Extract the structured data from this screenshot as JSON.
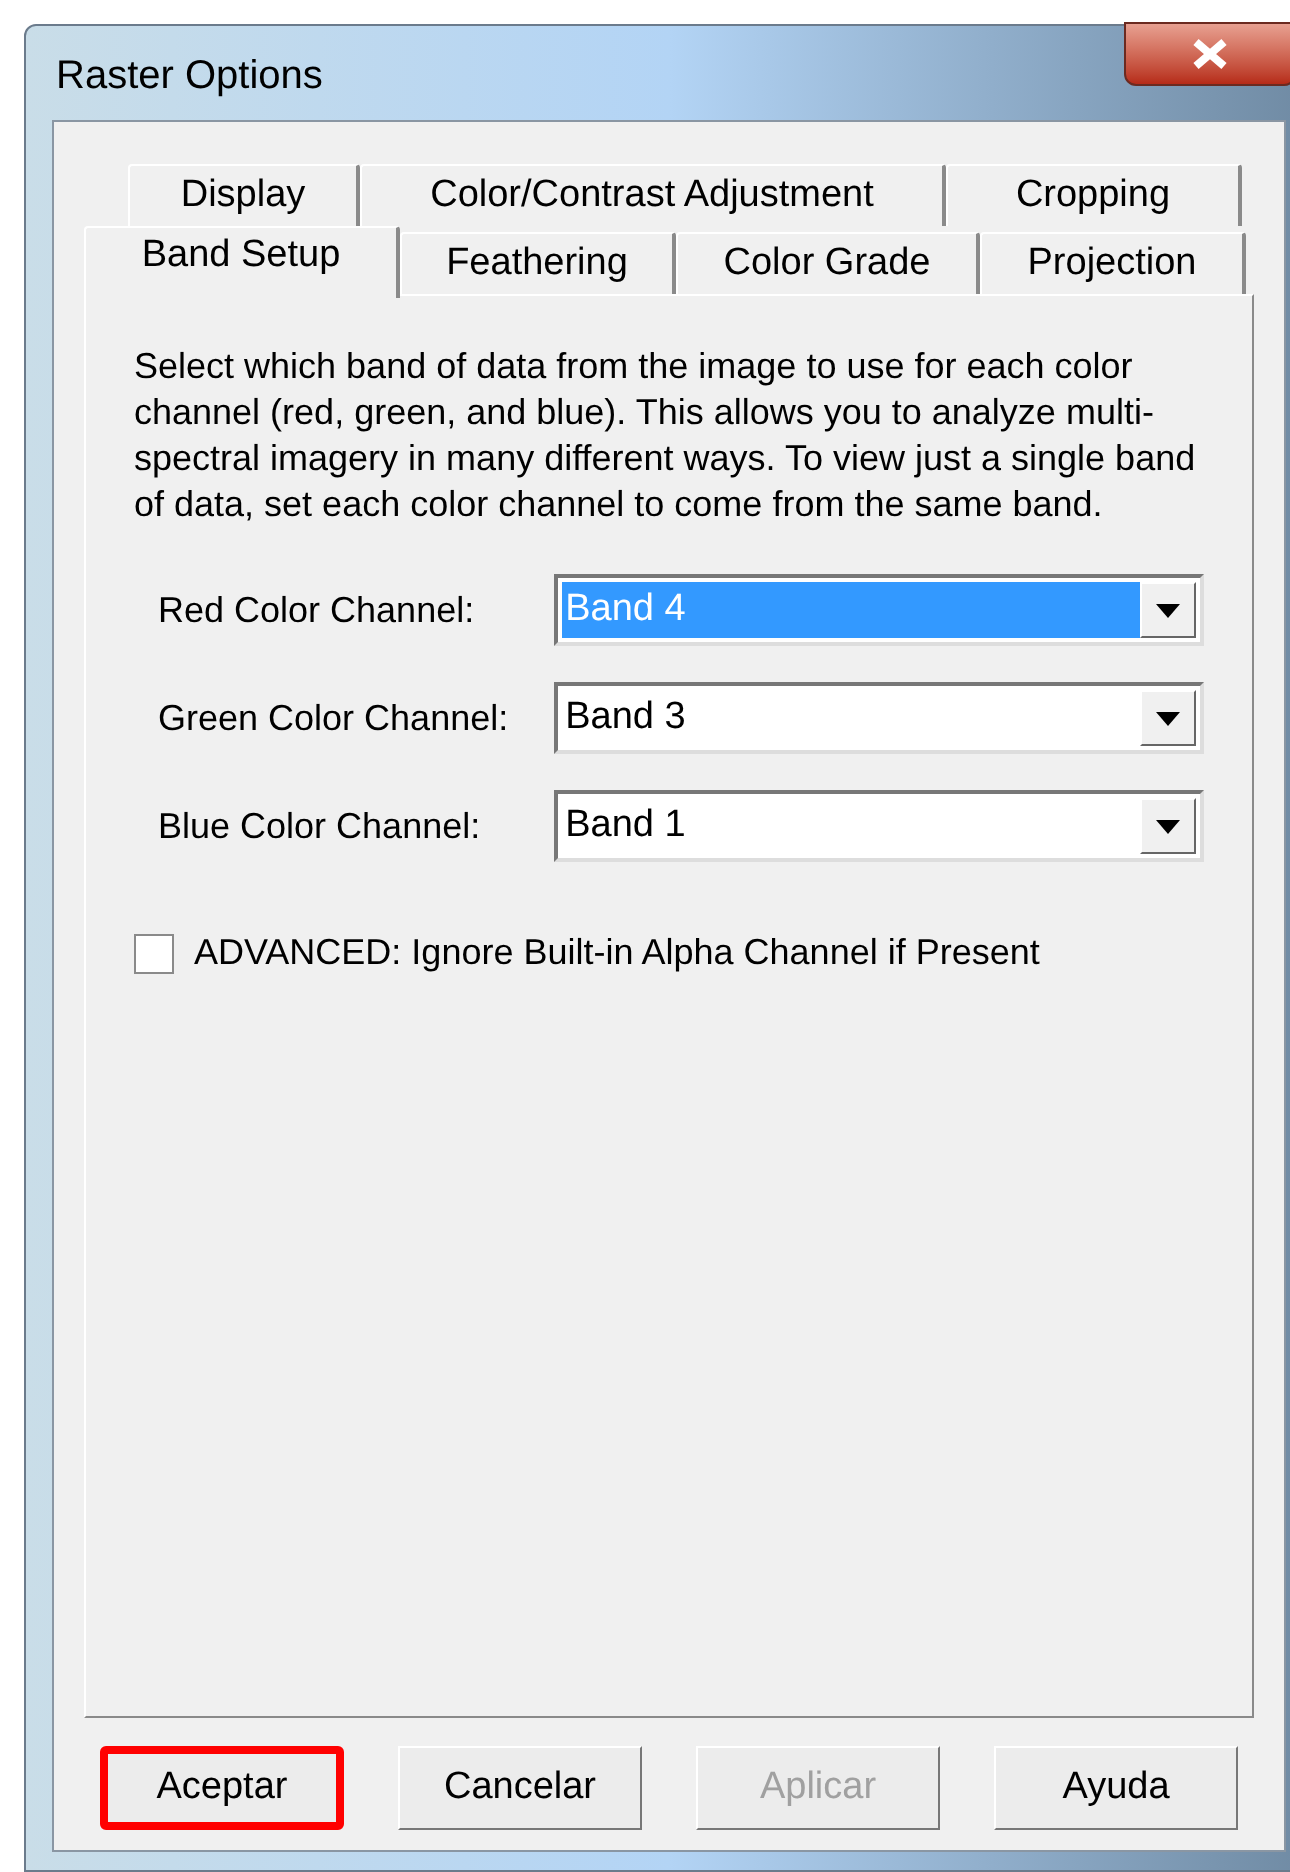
{
  "window": {
    "title": "Raster Options"
  },
  "tab_rows": [
    [
      {
        "label": "Display",
        "selected": false
      },
      {
        "label": "Color/Contrast Adjustment",
        "selected": false
      },
      {
        "label": "Cropping",
        "selected": false
      }
    ],
    [
      {
        "label": "Band Setup",
        "selected": true
      },
      {
        "label": "Feathering",
        "selected": false
      },
      {
        "label": "Color Grade",
        "selected": false
      },
      {
        "label": "Projection",
        "selected": false
      }
    ]
  ],
  "description": "Select which band of data from the image to use for each color channel (red, green, and blue). This allows you to analyze multi-spectral imagery in many different ways. To view just a single band of data, set each color channel to come from the same band.",
  "channels": [
    {
      "label": "Red Color Channel:",
      "value": "Band 4",
      "focused": true
    },
    {
      "label": "Green Color Channel:",
      "value": "Band 3",
      "focused": false
    },
    {
      "label": "Blue Color Channel:",
      "value": "Band 1",
      "focused": false
    }
  ],
  "advanced": {
    "label": "ADVANCED: Ignore Built-in Alpha Channel if Present",
    "checked": false
  },
  "buttons": [
    {
      "label": "Aceptar",
      "disabled": false,
      "highlighted": true
    },
    {
      "label": "Cancelar",
      "disabled": false,
      "highlighted": false
    },
    {
      "label": "Aplicar",
      "disabled": true,
      "highlighted": false
    },
    {
      "label": "Ayuda",
      "disabled": false,
      "highlighted": false
    }
  ]
}
